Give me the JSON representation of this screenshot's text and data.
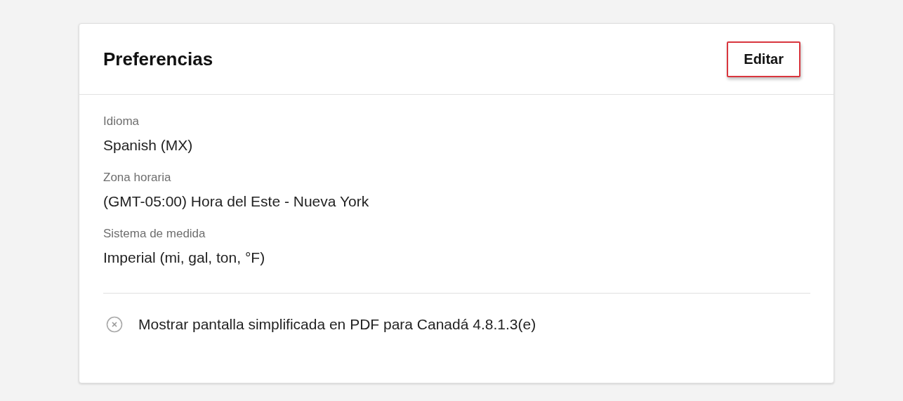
{
  "card": {
    "title": "Preferencias",
    "edit_button": {
      "label": "Editar",
      "highlighted": true
    }
  },
  "fields": [
    {
      "label": "Idioma",
      "value": "Spanish (MX)"
    },
    {
      "label": "Zona horaria",
      "value": "(GMT-05:00) Hora del Este - Nueva York"
    },
    {
      "label": "Sistema de medida",
      "value": "Imperial (mi, gal, ton, °F)"
    }
  ],
  "options": [
    {
      "label": "Mostrar pantalla simplificada en PDF para Canadá 4.8.1.3(e)",
      "enabled": false
    }
  ]
}
